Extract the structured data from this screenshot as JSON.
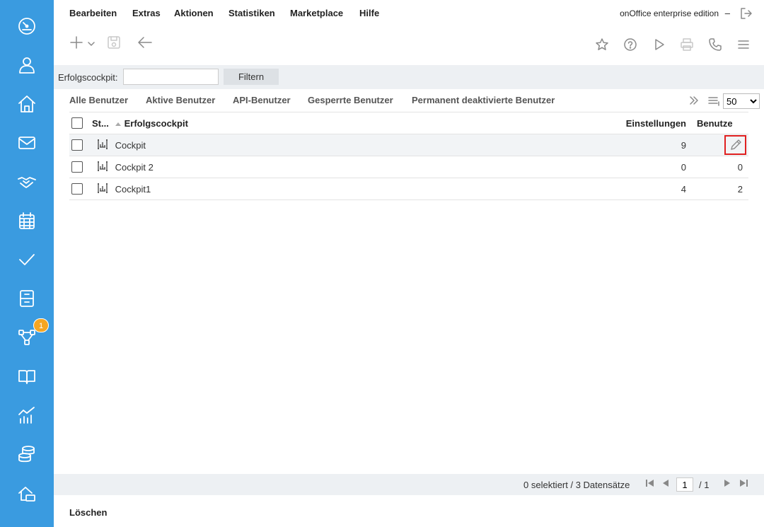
{
  "sidebar": {
    "items": [
      {
        "icon": "dashboard-icon"
      },
      {
        "icon": "user-icon"
      },
      {
        "icon": "home-icon"
      },
      {
        "icon": "mail-icon"
      },
      {
        "icon": "handshake-icon"
      },
      {
        "icon": "calendar-icon"
      },
      {
        "icon": "check-icon"
      },
      {
        "icon": "archive-icon"
      },
      {
        "icon": "workflow-icon",
        "badge": "1"
      },
      {
        "icon": "book-icon"
      },
      {
        "icon": "statistics-icon"
      },
      {
        "icon": "database-icon"
      },
      {
        "icon": "property-icon"
      }
    ]
  },
  "menu": {
    "items": [
      "Bearbeiten",
      "Extras",
      "Aktionen",
      "Statistiken",
      "Marketplace",
      "Hilfe"
    ],
    "edition": "onOffice enterprise edition",
    "dash": "–"
  },
  "filter": {
    "label": "Erfolgscockpit:",
    "value": "",
    "button": "Filtern"
  },
  "tabs": [
    "Alle Benutzer",
    "Aktive Benutzer",
    "API-Benutzer",
    "Gesperrte Benutzer",
    "Permanent deaktivierte Benutzer"
  ],
  "per_page": "50",
  "table": {
    "headers": {
      "status": "St...",
      "name": "Erfolgscockpit",
      "settings": "Einstellungen",
      "users": "Benutze"
    },
    "rows": [
      {
        "name": "Cockpit",
        "settings": "9",
        "users": ""
      },
      {
        "name": "Cockpit 2",
        "settings": "0",
        "users": "0"
      },
      {
        "name": "Cockpit1",
        "settings": "4",
        "users": "2"
      }
    ]
  },
  "status": {
    "text": "0 selektiert / 3 Datensätze",
    "page": "1",
    "total": "/ 1"
  },
  "footer": {
    "delete": "Löschen"
  },
  "colors": {
    "sidebar": "#3a9be0",
    "badge": "#f5a623",
    "highlight": "#e02020"
  }
}
